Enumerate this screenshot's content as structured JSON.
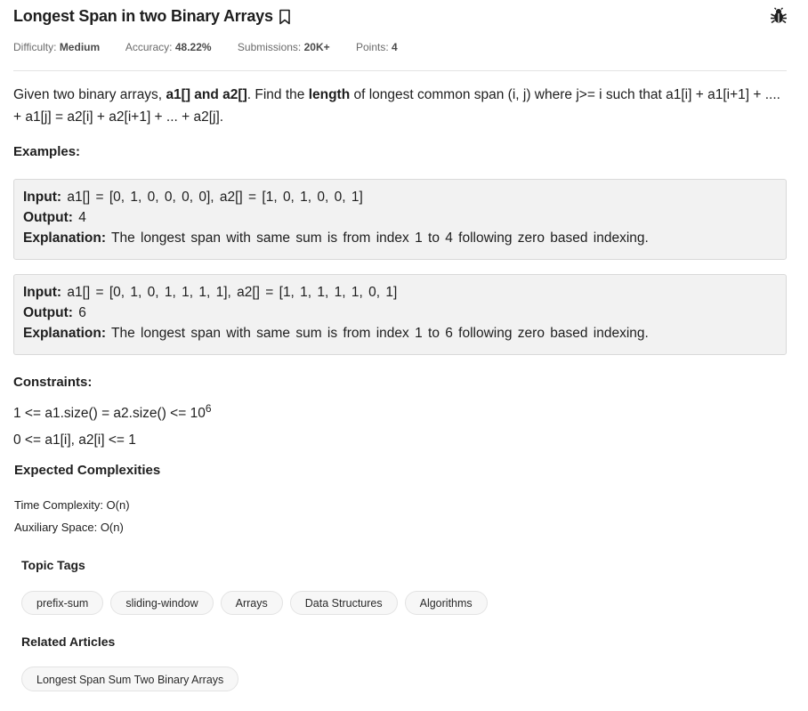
{
  "problem": {
    "title": "Longest Span in two Binary Arrays",
    "meta": {
      "difficulty_label": "Difficulty:",
      "difficulty_value": "Medium",
      "accuracy_label": "Accuracy:",
      "accuracy_value": "48.22%",
      "submissions_label": "Submissions:",
      "submissions_value": "20K+",
      "points_label": "Points:",
      "points_value": "4"
    },
    "statement": {
      "part1": "Given two binary arrays, ",
      "bold1": "a1[] and a2[]",
      "part2": ". Find the ",
      "bold2": "length",
      "part3": " of longest common span (i, j) where j>= i such that a1[i] + a1[i+1] + .... + a1[j] =  a2[i] + a2[i+1] + ... + a2[j]."
    },
    "examples_label": "Examples:",
    "examples": [
      {
        "input_label": "Input:",
        "input": " a1[] = [0, 1, 0, 0, 0, 0], a2[] = [1, 0, 1, 0, 0, 1]",
        "output_label": "Output:",
        "output": " 4",
        "explanation_label": "Explanation:",
        "explanation": " The longest span with same sum is from index 1 to 4 following zero based indexing."
      },
      {
        "input_label": "Input:",
        "input": " a1[] = [0, 1, 0, 1, 1, 1, 1], a2[] = [1, 1, 1, 1, 1, 0, 1]",
        "output_label": "Output:",
        "output": " 6",
        "explanation_label": "Explanation:",
        "explanation": " The longest span with same sum is from index 1 to 6 following zero based indexing."
      }
    ],
    "constraints_label": "Constraints:",
    "constraints": {
      "line1_base": "1 <= a1.size() = a2.size() <= 10",
      "line1_exp": "6",
      "line2": "0 <= a1[i], a2[i] <= 1"
    },
    "complexities": {
      "title": "Expected Complexities",
      "time": "Time Complexity: O(n)",
      "space": "Auxiliary Space: O(n)"
    },
    "topic_tags_title": "Topic Tags",
    "topic_tags": [
      "prefix-sum",
      "sliding-window",
      "Arrays",
      "Data Structures",
      "Algorithms"
    ],
    "related_title": "Related Articles",
    "related_articles": [
      "Longest Span Sum Two Binary Arrays"
    ]
  },
  "icons": {
    "bookmark": "bookmark-icon",
    "report": "bug-icon"
  }
}
